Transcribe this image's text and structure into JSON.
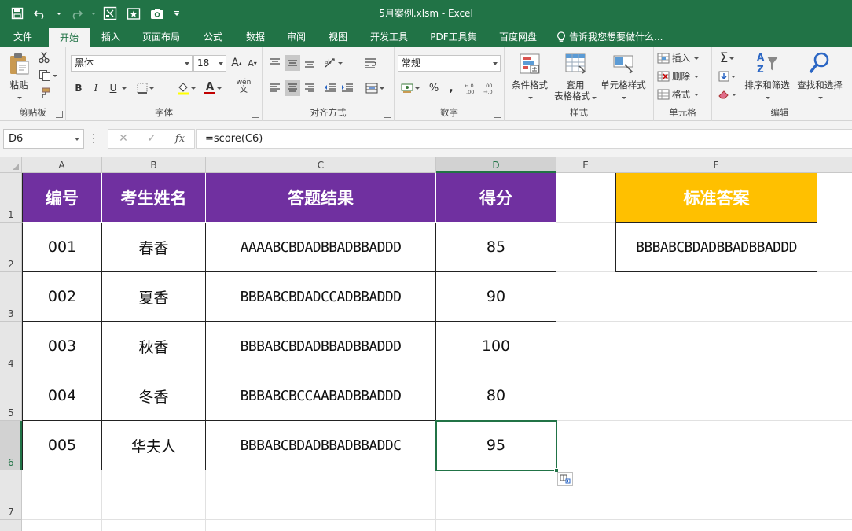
{
  "window": {
    "title": "5月案例.xlsm - Excel"
  },
  "tabs": [
    {
      "label": "文件"
    },
    {
      "label": "开始"
    },
    {
      "label": "插入"
    },
    {
      "label": "页面布局"
    },
    {
      "label": "公式"
    },
    {
      "label": "数据"
    },
    {
      "label": "审阅"
    },
    {
      "label": "视图"
    },
    {
      "label": "开发工具"
    },
    {
      "label": "PDF工具集"
    },
    {
      "label": "百度网盘"
    }
  ],
  "tell_me": "告诉我您想要做什么...",
  "ribbon": {
    "clipboard": {
      "label": "剪贴板",
      "paste": "粘贴"
    },
    "font": {
      "label": "字体",
      "font_name": "黑体",
      "font_size": "18",
      "bold": "B",
      "italic": "I",
      "underline": "U",
      "grow": "A",
      "shrink": "A",
      "phonetic": "wén",
      "font_color_letter": "A"
    },
    "alignment": {
      "label": "对齐方式"
    },
    "number": {
      "label": "数字",
      "format": "常规",
      "percent": "%",
      "comma": ","
    },
    "styles": {
      "label": "样式",
      "conditional": "条件格式",
      "table_line1": "套用",
      "table_line2": "表格格式",
      "cell_styles": "单元格样式"
    },
    "cells": {
      "label": "单元格",
      "insert": "插入",
      "delete": "删除",
      "format": "格式"
    },
    "editing": {
      "label": "编辑",
      "sort_filter": "排序和筛选",
      "find_select": "查找和选择"
    }
  },
  "formula_bar": {
    "name_box": "D6",
    "cancel": "✕",
    "enter": "✓",
    "fx": "fx",
    "formula": "=score(C6)"
  },
  "sheet": {
    "columns": [
      "A",
      "B",
      "C",
      "D",
      "E",
      "F"
    ],
    "rows": [
      "1",
      "2",
      "3",
      "4",
      "5",
      "6",
      "7"
    ],
    "header": [
      "编号",
      "考生姓名",
      "答题结果",
      "得分"
    ],
    "records": [
      {
        "id": "001",
        "name": "春香",
        "answers": "AAAABCBDADBBADBBADDD",
        "score": "85"
      },
      {
        "id": "002",
        "name": "夏香",
        "answers": "BBBABCBDADCCADBBADDD",
        "score": "90"
      },
      {
        "id": "003",
        "name": "秋香",
        "answers": "BBBABCBDADBBADBBADDD",
        "score": "100"
      },
      {
        "id": "004",
        "name": "冬香",
        "answers": "BBBABCBCCAABADBBADDD",
        "score": "80"
      },
      {
        "id": "005",
        "name": "华夫人",
        "answers": "BBBABCBDADBBADBBADDC",
        "score": "95"
      }
    ],
    "answer_key_title": "标准答案",
    "answer_key": "BBBABCBDADBBADBBADDD",
    "active_cell": "D6"
  },
  "colors": {
    "excel_green": "#217346",
    "header_purple": "#7030a0",
    "key_gold": "#ffc000"
  }
}
